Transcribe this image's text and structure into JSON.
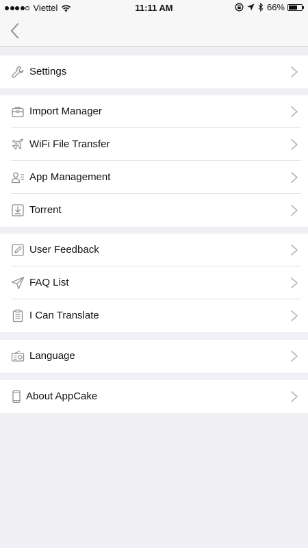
{
  "status_bar": {
    "carrier": "Viettel",
    "time": "11:11 AM",
    "battery_percent": "66%",
    "battery_level": 0.66,
    "icons": [
      "signal-dots",
      "wifi-icon",
      "screen-lock-icon",
      "location-arrow-icon",
      "bluetooth-icon",
      "battery-icon"
    ]
  },
  "nav": {
    "back_icon": "chevron-left-icon"
  },
  "menu": {
    "settings": {
      "label": "Settings",
      "icon": "wrench-icon"
    },
    "import_manager": {
      "label": "Import Manager",
      "icon": "briefcase-icon"
    },
    "wifi_file_transfer": {
      "label": "WiFi File Transfer",
      "icon": "airplane-icon"
    },
    "app_management": {
      "label": "App Management",
      "icon": "user-list-icon"
    },
    "torrent": {
      "label": "Torrent",
      "icon": "download-tray-icon"
    },
    "user_feedback": {
      "label": "User Feedback",
      "icon": "pencil-icon"
    },
    "faq_list": {
      "label": "FAQ List",
      "icon": "paper-plane-icon"
    },
    "i_can_translate": {
      "label": "I Can Translate",
      "icon": "clipboard-icon"
    },
    "language": {
      "label": "Language",
      "icon": "radio-icon"
    },
    "about_appcake": {
      "label": "About AppCake",
      "icon": "phone-icon"
    }
  },
  "colors": {
    "background": "#efeff4",
    "row_background": "#ffffff",
    "icon_gray": "#8e8e93",
    "chevron_gray": "#b8b8bc"
  }
}
